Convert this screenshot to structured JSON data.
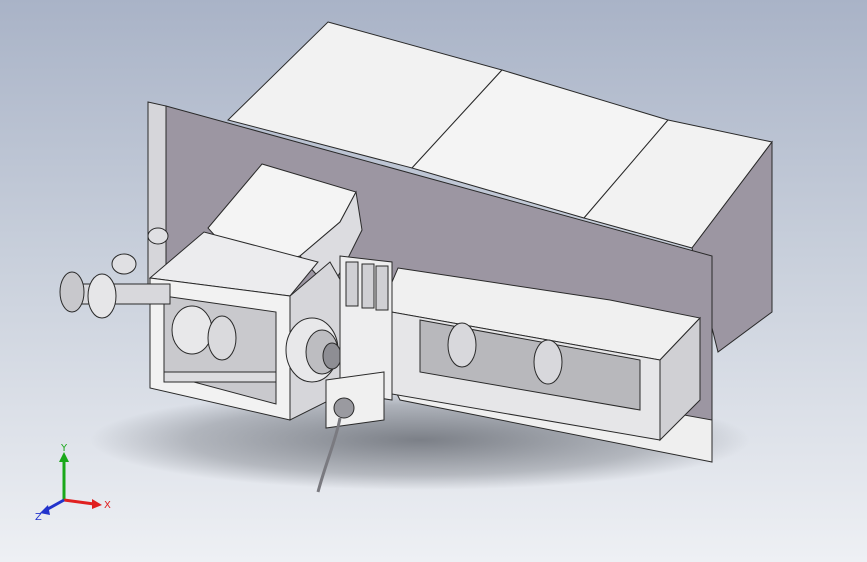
{
  "viewport": {
    "background_top": "#a9b3c7",
    "background_bottom": "#eef0f4"
  },
  "model": {
    "housing_color": "#f2f2f2",
    "shade_color": "#9c96a2",
    "edge_color": "#2a2a2a",
    "accent_color": "#b8b8bc"
  },
  "triad": {
    "x_label": "X",
    "y_label": "Y",
    "z_label": "Z",
    "x_color": "#e02020",
    "y_color": "#1aa81a",
    "z_color": "#2233cc"
  }
}
